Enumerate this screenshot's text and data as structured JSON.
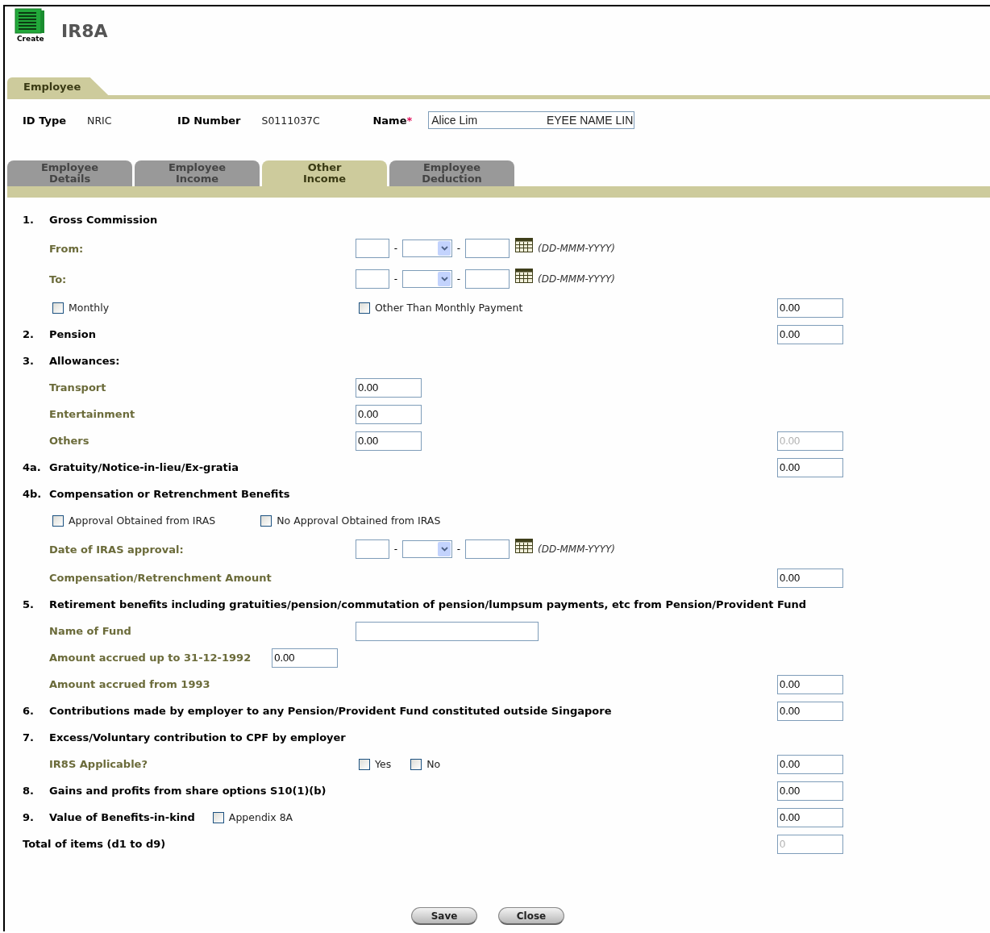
{
  "header": {
    "icon_label": "Create",
    "title": "IR8A"
  },
  "section_tab": "Employee",
  "info": [
    {
      "label": "ID Type",
      "value": "NRIC"
    },
    {
      "label": "ID Number",
      "value": "S0111037C"
    }
  ],
  "name_field": {
    "label": "Name",
    "required_mark": "*",
    "value_parts": [
      "Alice Lim",
      "EYEE NAME LIN"
    ]
  },
  "tabs": [
    {
      "label": "Employee Details",
      "selected": false
    },
    {
      "label": "Employee Income",
      "selected": false
    },
    {
      "label": "Other Income",
      "selected": true
    },
    {
      "label": "Employee Deduction",
      "selected": false
    }
  ],
  "rows": [
    {
      "kind": "section",
      "num": "1.",
      "label": "Gross Commission"
    },
    {
      "kind": "sub",
      "label": "From:",
      "mid": {
        "kind": "date",
        "separator": "-",
        "hint": "(DD-MMM-YYYY)"
      }
    },
    {
      "kind": "sub",
      "label": "To:",
      "mid": {
        "kind": "date",
        "separator": "-",
        "hint": "(DD-MMM-YYYY)"
      }
    },
    {
      "kind": "checks",
      "left": [
        {
          "label": "Monthly",
          "checked": false
        }
      ],
      "mid": {
        "kind": "checks",
        "items": [
          {
            "label": "Other Than Monthly Payment",
            "checked": false
          }
        ]
      },
      "amount": {
        "value": "0.00",
        "disabled": false
      }
    },
    {
      "kind": "section",
      "num": "2.",
      "label": "Pension",
      "amount": {
        "value": "0.00",
        "disabled": false
      }
    },
    {
      "kind": "section",
      "num": "3.",
      "label": "Allowances:"
    },
    {
      "kind": "sub",
      "label": "Transport",
      "mid": {
        "kind": "amount",
        "value": "0.00"
      }
    },
    {
      "kind": "sub",
      "label": "Entertainment",
      "mid": {
        "kind": "amount",
        "value": "0.00"
      }
    },
    {
      "kind": "sub",
      "label": "Others",
      "mid": {
        "kind": "amount",
        "value": "0.00"
      },
      "amount": {
        "value": "0.00",
        "disabled": true
      }
    },
    {
      "kind": "section",
      "num": "4a.",
      "label": "Gratuity/Notice-in-lieu/Ex-gratia",
      "amount": {
        "value": "0.00",
        "disabled": false
      }
    },
    {
      "kind": "section",
      "num": "4b.",
      "label": "Compensation or Retrenchment Benefits"
    },
    {
      "kind": "checks",
      "left": [
        {
          "label": "Approval Obtained from IRAS",
          "checked": false
        },
        {
          "label": "No Approval Obtained from IRAS",
          "checked": false
        }
      ]
    },
    {
      "kind": "sub",
      "label": "Date of IRAS approval:",
      "mid": {
        "kind": "date",
        "separator": "-",
        "hint": "(DD-MMM-YYYY)"
      }
    },
    {
      "kind": "sub",
      "label": "Compensation/Retrenchment Amount",
      "amount": {
        "value": "0.00",
        "disabled": false
      }
    },
    {
      "kind": "section",
      "num": "5.",
      "label": "Retirement benefits including gratuities/pension/commutation of pension/lumpsum payments, etc from Pension/Provident Fund"
    },
    {
      "kind": "sub",
      "label": "Name of Fund",
      "mid": {
        "kind": "text"
      }
    },
    {
      "kind": "sub",
      "label": "Amount accrued up to 31-12-1992",
      "inline": {
        "kind": "amount",
        "value": "0.00"
      }
    },
    {
      "kind": "sub",
      "label": "Amount accrued from 1993",
      "amount": {
        "value": "0.00",
        "disabled": false
      }
    },
    {
      "kind": "section",
      "num": "6.",
      "label": "Contributions made by employer to any Pension/Provident Fund constituted outside Singapore",
      "amount": {
        "value": "0.00",
        "disabled": false
      }
    },
    {
      "kind": "section",
      "num": "7.",
      "label": "Excess/Voluntary contribution to CPF by employer"
    },
    {
      "kind": "sub",
      "label": "IR8S Applicable?",
      "mid": {
        "kind": "checks",
        "items": [
          {
            "label": "Yes",
            "checked": false
          },
          {
            "label": "No",
            "checked": false
          }
        ]
      },
      "amount": {
        "value": "0.00",
        "disabled": false
      }
    },
    {
      "kind": "section",
      "num": "8.",
      "label": "Gains and profits from share options S10(1)(b)",
      "amount": {
        "value": "0.00",
        "disabled": false
      }
    },
    {
      "kind": "section",
      "num": "9.",
      "label": "Value of Benefits-in-kind",
      "inline": {
        "kind": "checks",
        "items": [
          {
            "label": "Appendix 8A",
            "checked": false
          }
        ]
      },
      "amount": {
        "value": "0.00",
        "disabled": false
      }
    },
    {
      "kind": "total",
      "label": "Total of items (d1 to d9)",
      "amount": {
        "value": "0",
        "disabled": true
      }
    }
  ],
  "buttons": [
    {
      "label": "Save"
    },
    {
      "label": "Close"
    }
  ]
}
